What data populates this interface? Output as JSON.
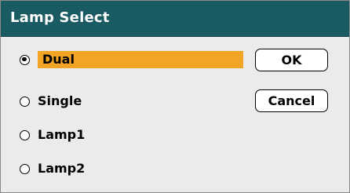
{
  "dialog": {
    "title": "Lamp Select"
  },
  "options": {
    "items": [
      {
        "label": "Dual",
        "selected": true
      },
      {
        "label": "Single",
        "selected": false
      },
      {
        "label": "Lamp1",
        "selected": false
      },
      {
        "label": "Lamp2",
        "selected": false
      }
    ],
    "highlight_color": "#f2a424"
  },
  "buttons": {
    "ok_label": "OK",
    "cancel_label": "Cancel"
  },
  "colors": {
    "title_bar": "#195a63",
    "body": "#ebebeb"
  }
}
